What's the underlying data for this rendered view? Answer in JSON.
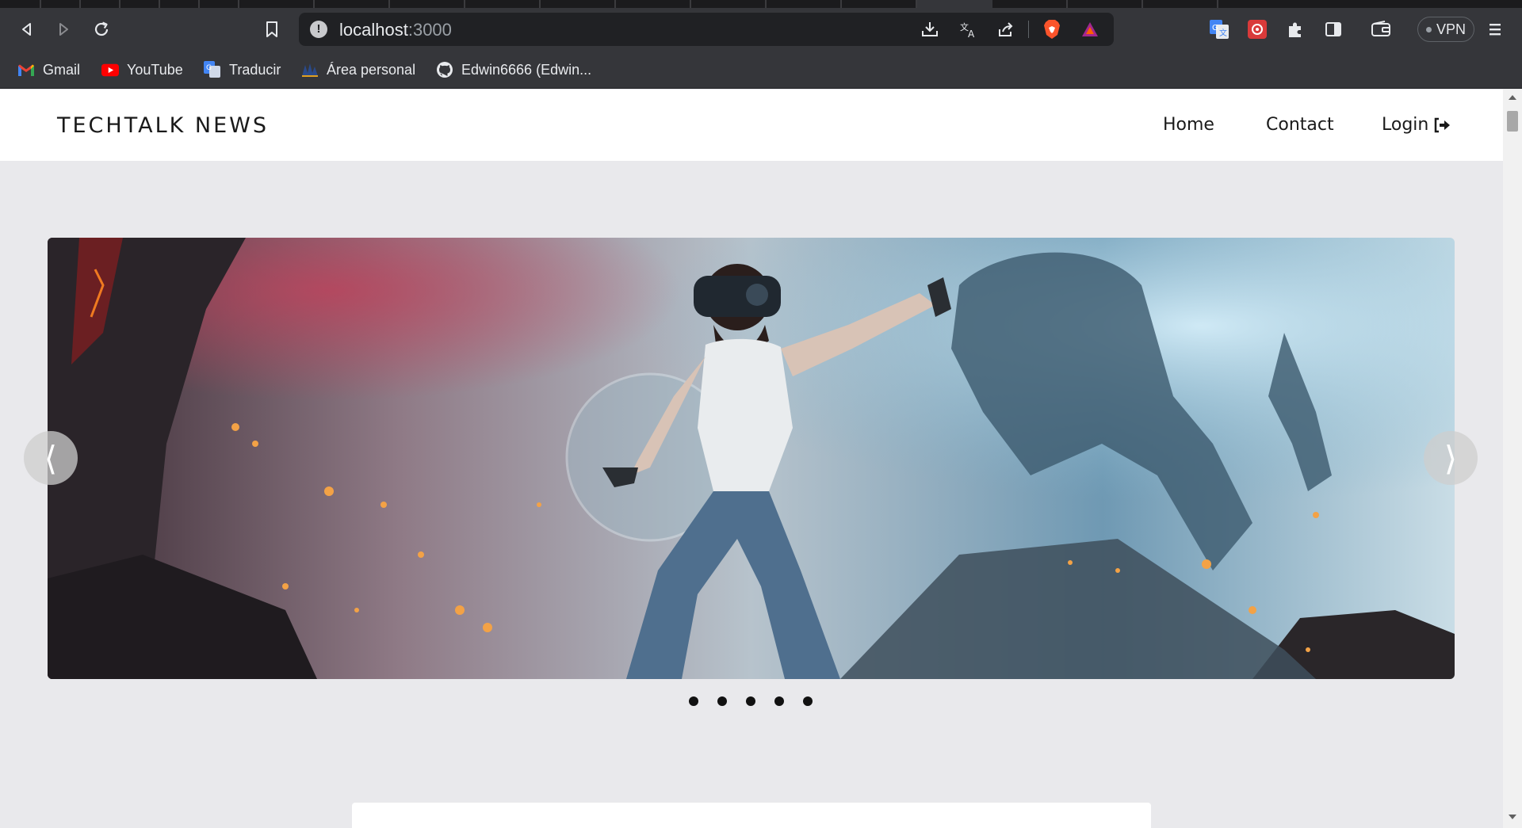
{
  "browser": {
    "url_host": "localhost",
    "url_port": ":3000",
    "vpn_label": "VPN",
    "bookmarks": [
      {
        "label": "Gmail",
        "icon": "gmail-icon"
      },
      {
        "label": "YouTube",
        "icon": "youtube-icon"
      },
      {
        "label": "Traducir",
        "icon": "translate-icon"
      },
      {
        "label": "Área personal",
        "icon": "area-personal-icon"
      },
      {
        "label": "Edwin6666 (Edwin...",
        "icon": "github-icon"
      }
    ]
  },
  "site": {
    "brand": "TECHTALK NEWS",
    "nav": {
      "home": "Home",
      "contact": "Contact",
      "login": "Login"
    }
  },
  "carousel": {
    "prev_label": "⟨",
    "next_label": "⟩",
    "slide_count": 5
  },
  "colors": {
    "page_bg": "#e9e9ec",
    "navbar_bg": "#ffffff",
    "chrome_bg": "#35363a",
    "omnibox_bg": "#202124"
  }
}
